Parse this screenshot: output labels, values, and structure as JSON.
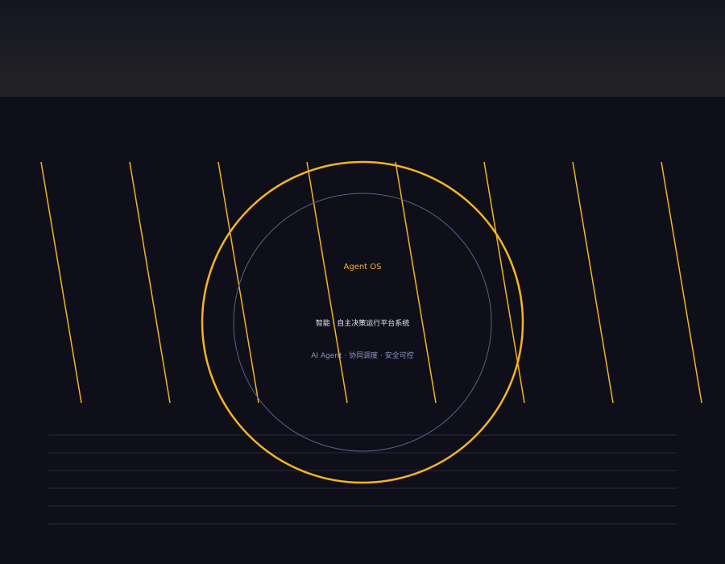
{
  "brand": {
    "name": "Agent OS",
    "tagline": "智能 · 自主决策运行平台系统",
    "subtitle": "AI Agent · 协同调度 · 安全可控"
  },
  "colors": {
    "background": "#0f0f1a",
    "accent": "#f5b41f",
    "inner_ring": "#5a5f8a",
    "rule_line": "#2a2a40",
    "tagline_text": "#e6e8f2",
    "subtitle_text": "#8e98c4"
  }
}
